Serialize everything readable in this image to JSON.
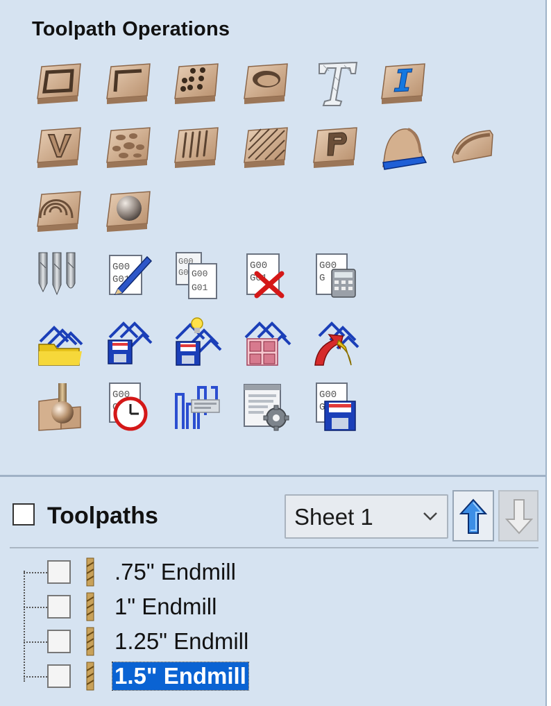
{
  "panel": {
    "title": "Toolpath Operations",
    "rows": [
      [
        "profile-toolpath-icon",
        "pocket-toolpath-icon",
        "drilling-toolpath-icon",
        "inlay-toolpath-icon",
        "text-engraving-icon",
        "vcarve-text-icon"
      ],
      [
        "vcarve-toolpath-icon",
        "texture-toolpath-icon",
        "fluting-toolpath-icon",
        "prism-carving-icon",
        "photo-vcarve-icon",
        "moulding-toolpath-icon",
        "edge-profile-icon"
      ],
      [
        "ripple-toolpath-icon",
        "3d-dome-icon"
      ],
      [
        "tool-database-icon",
        "edit-toolpath-icon",
        "merge-toolpaths-icon",
        "delete-toolpath-icon",
        "toolpath-calculator-icon"
      ],
      [
        "open-template-icon",
        "save-template-icon",
        "template-wizard-icon",
        "template-group-icon",
        "merge-template-icon"
      ],
      [
        "3d-preview-icon",
        "time-estimate-icon",
        "toolpath-summary-icon",
        "postprocessor-settings-icon",
        "save-toolpath-icon"
      ]
    ]
  },
  "toolpaths": {
    "title": "Toolpaths",
    "sheet": "Sheet 1",
    "items": [
      {
        "name": ".75\" Endmill",
        "selected": false
      },
      {
        "name": "1\" Endmill",
        "selected": false
      },
      {
        "name": "1.25\" Endmill",
        "selected": false
      },
      {
        "name": "1.5\" Endmill",
        "selected": true
      }
    ]
  },
  "colors": {
    "panel_bg": "#d6e3f1",
    "wood": "#d8b89a",
    "selection": "#0a63d3"
  }
}
